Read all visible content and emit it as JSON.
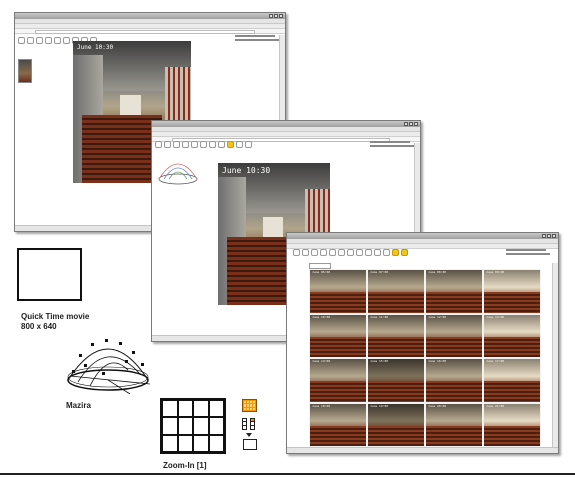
{
  "window1": {
    "stamp": "June 10:30"
  },
  "window2": {
    "stamp": "June 10:30"
  },
  "window3": {
    "grid": [
      [
        "June 06:00",
        "June 07:00",
        "June 08:00",
        "June 09:00"
      ],
      [
        "June 10:00",
        "June 11:00",
        "June 12:00",
        "June 13:00"
      ],
      [
        "June 14:00",
        "June 15:00",
        "June 16:00",
        "June 17:00"
      ],
      [
        "June 18:00",
        "June 19:00",
        "June 20:00",
        "June 21:00"
      ]
    ]
  },
  "annotations": {
    "quicktime_line1": "Quick Time movie",
    "quicktime_line2": "800 x 640",
    "mazira": "Mazira",
    "zoom": "Zoom-In [1]"
  },
  "colors": {
    "highlight": "#f2c31a",
    "pew": "#7a2f1a",
    "frame": "#7a7a7a"
  }
}
